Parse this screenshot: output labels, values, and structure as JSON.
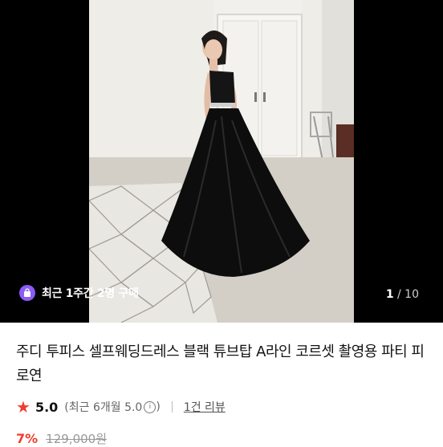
{
  "product": {
    "title": "주디 투피스 셀프웨딩드레스 블랙 튜브탑 A라인 코르셋 촬영용 파티 피로연",
    "rating": "5.0",
    "recent_rating": "(최근 6개월 5.0",
    "recent_rating_close": ")",
    "review_link": "1건 리뷰",
    "discount": "7%",
    "original_price": "129,000원"
  },
  "gallery": {
    "badge_text": "최근 1주간 2명 구매",
    "current": "1",
    "total": "/ 10"
  },
  "colors": {
    "accent": "#f03c2e",
    "badge": "#8b5cf6"
  }
}
